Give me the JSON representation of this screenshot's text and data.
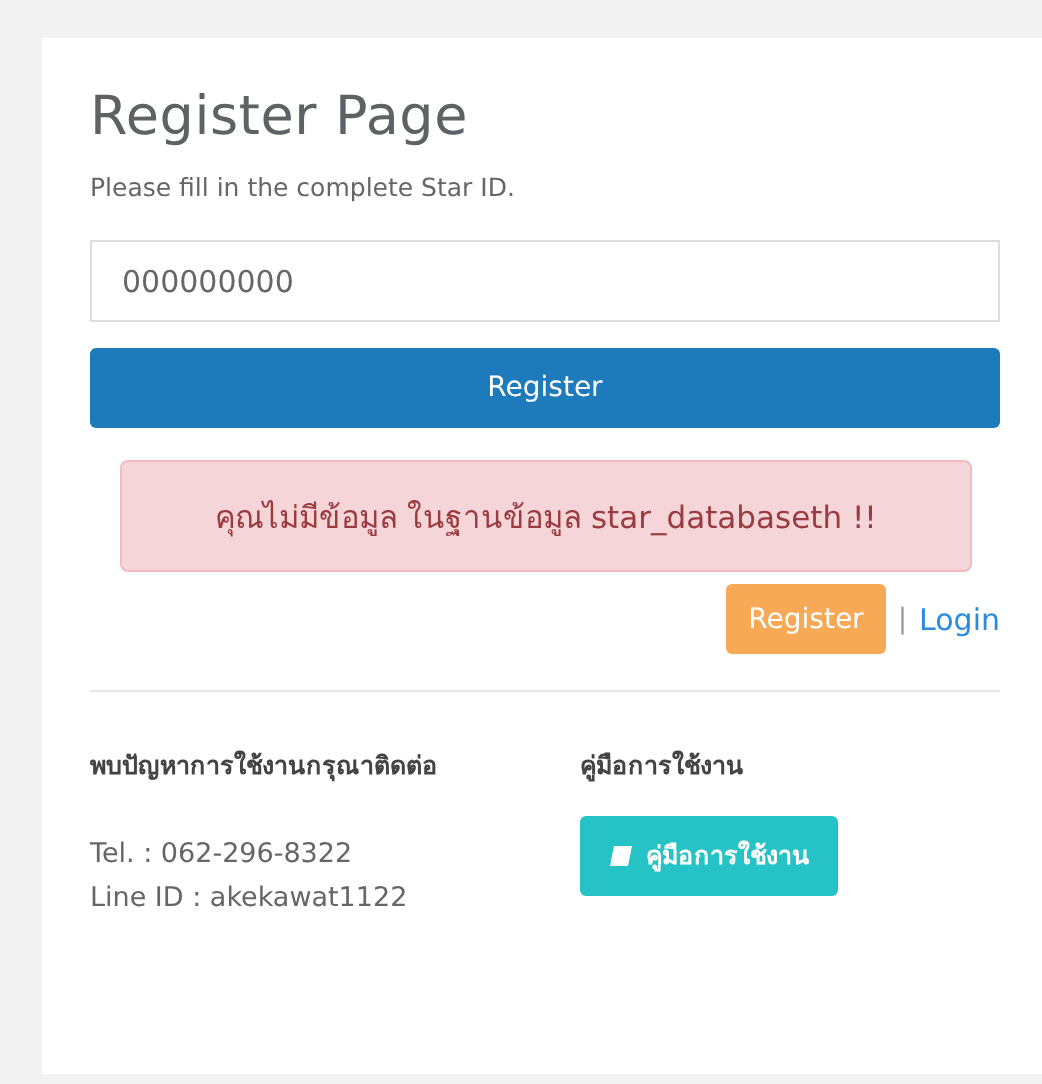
{
  "title": "Register Page",
  "subtitle": "Please fill in the complete Star ID.",
  "star_id_field": {
    "value": "000000000"
  },
  "submit_button": "Register",
  "alert": {
    "kind": "danger",
    "text": "คุณไม่มีข้อมูล ในฐานข้อมูล star_databaseth !!"
  },
  "nav": {
    "register": "Register",
    "separator": "|",
    "login": "Login"
  },
  "contact": {
    "heading": "พบปัญหาการใช้งานกรุณาติดต่อ",
    "lines": [
      "Tel. : 062-296-8322",
      "Line ID : akekawat1122"
    ]
  },
  "manual": {
    "heading": "คู่มือการใช้งาน",
    "button": "คู่มือการใช้งาน"
  }
}
